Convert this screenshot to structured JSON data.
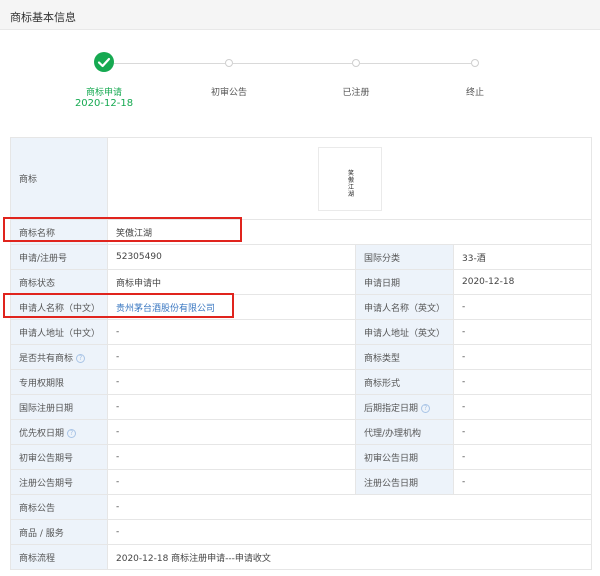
{
  "header": {
    "title": "商标基本信息"
  },
  "steps": [
    {
      "label": "商标申请",
      "date": "2020-12-18",
      "status": "done"
    },
    {
      "label": "初审公告",
      "status": "pending"
    },
    {
      "label": "已注册",
      "status": "pending"
    },
    {
      "label": "终止",
      "status": "pending"
    }
  ],
  "colors": {
    "done": "#16a951",
    "label_bg": "#edf3fa",
    "link": "#3b78c2",
    "highlight": "#e0241d"
  },
  "trademark": {
    "label": "商标",
    "image_text": "笑傲江湖"
  },
  "fields": {
    "name": {
      "label": "商标名称",
      "value": "笑傲江湖"
    },
    "reg_no": {
      "label": "申请/注册号",
      "value": "52305490"
    },
    "intl_class": {
      "label": "国际分类",
      "value": "33-酒"
    },
    "status": {
      "label": "商标状态",
      "value": "商标申请中"
    },
    "apply_date": {
      "label": "申请日期",
      "value": "2020-12-18"
    },
    "applicant_cn": {
      "label": "申请人名称（中文）",
      "value": "贵州茅台酒股份有限公司"
    },
    "applicant_en": {
      "label": "申请人名称（英文）",
      "value": "-"
    },
    "address_cn": {
      "label": "申请人地址（中文）",
      "value": "-"
    },
    "address_en": {
      "label": "申请人地址（英文）",
      "value": "-"
    },
    "shared": {
      "label": "是否共有商标",
      "value": "-",
      "help_icon": "question-icon"
    },
    "tm_type": {
      "label": "商标类型",
      "value": "-"
    },
    "exclusive_period": {
      "label": "专用权期限",
      "value": "-"
    },
    "tm_form": {
      "label": "商标形式",
      "value": "-"
    },
    "intl_reg_date": {
      "label": "国际注册日期",
      "value": "-"
    },
    "later_date": {
      "label": "后期指定日期",
      "value": "-",
      "help_icon": "question-icon"
    },
    "priority_date": {
      "label": "优先权日期",
      "value": "-",
      "help_icon": "question-icon"
    },
    "agency": {
      "label": "代理/办理机构",
      "value": "-"
    },
    "prelim_no": {
      "label": "初审公告期号",
      "value": "-"
    },
    "prelim_date": {
      "label": "初审公告日期",
      "value": "-"
    },
    "reg_ann_no": {
      "label": "注册公告期号",
      "value": "-"
    },
    "reg_ann_date": {
      "label": "注册公告日期",
      "value": "-"
    },
    "announcement": {
      "label": "商标公告",
      "value": "-"
    },
    "goods": {
      "label": "商品 / 服务",
      "value": "-"
    },
    "process": {
      "label": "商标流程",
      "value": "2020-12-18 商标注册申请---申请收文"
    }
  },
  "help_glyph": "?"
}
